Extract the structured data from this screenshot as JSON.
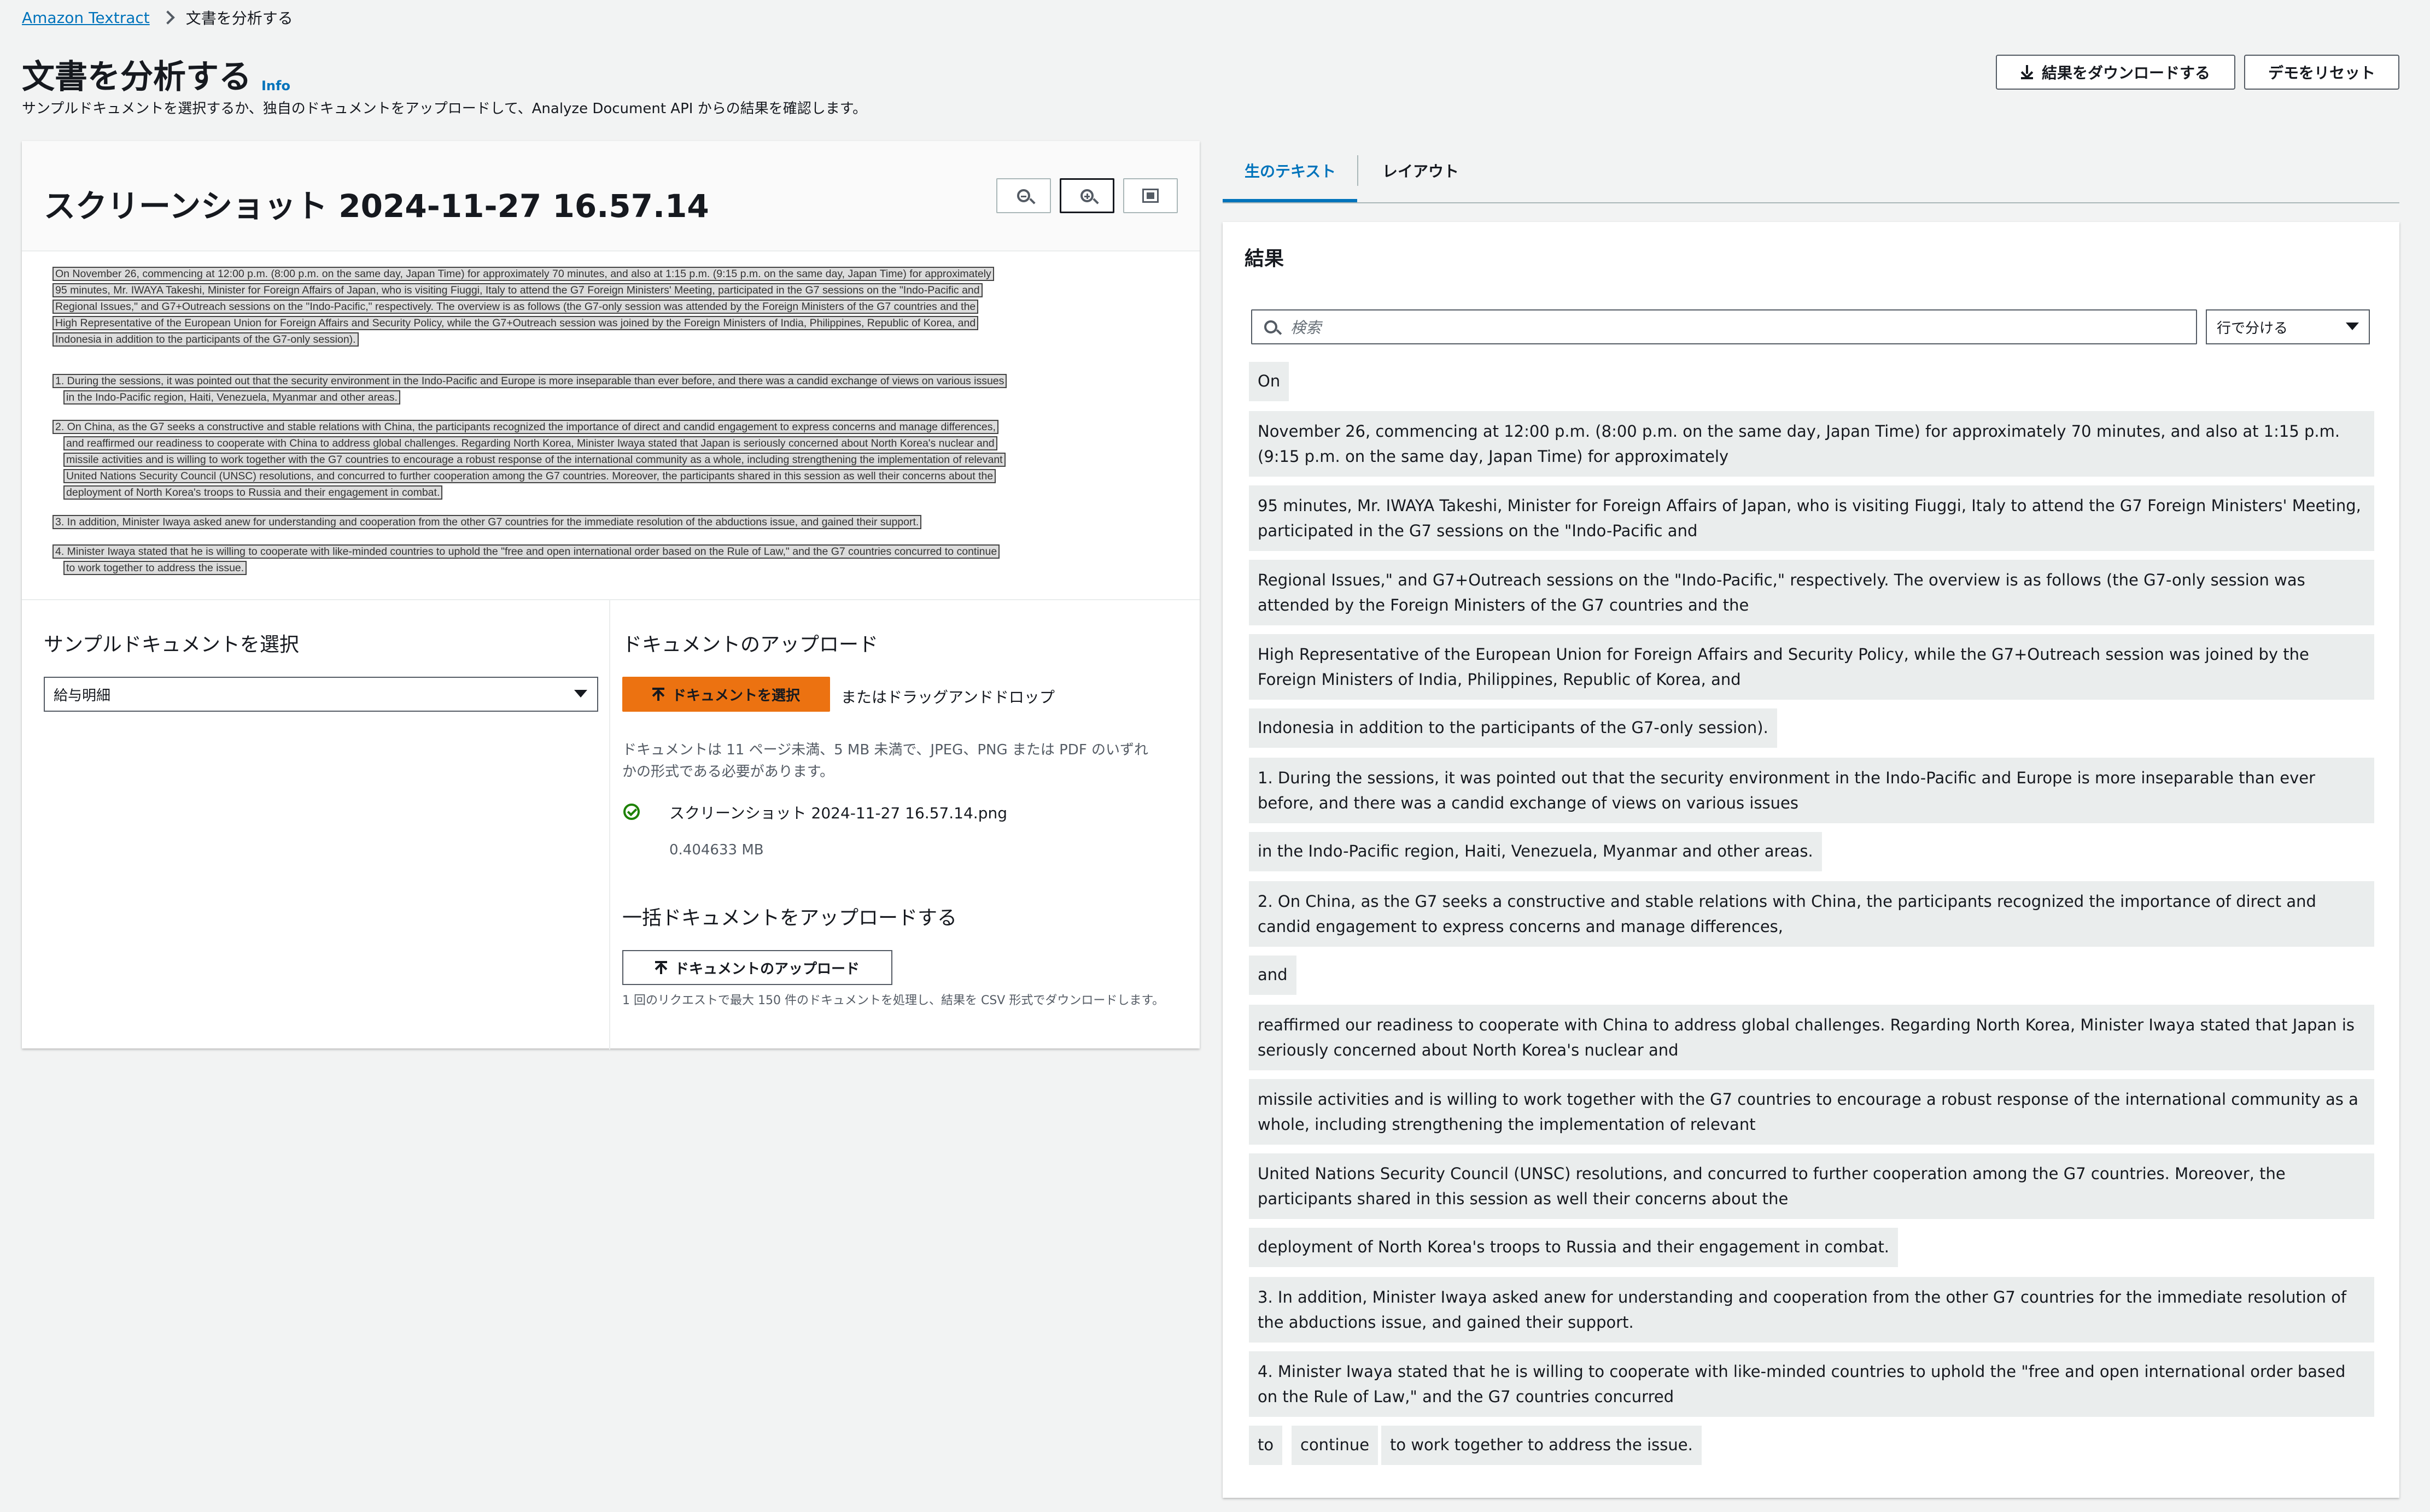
{
  "breadcrumb": {
    "root": "Amazon Textract",
    "current": "文書を分析する"
  },
  "header": {
    "title": "文書を分析する",
    "info": "Info",
    "description": "サンプルドキュメントを選択するか、独自のドキュメントをアップロードして、Analyze Document API からの結果を確認します。",
    "download_label": "結果をダウンロードする",
    "reset_label": "デモをリセット"
  },
  "document": {
    "title": "スクリーンショット 2024-11-27 16.57.14",
    "preview_lines": [
      "On November 26, commencing at 12:00 p.m. (8:00 p.m. on the same day, Japan Time) for approximately 70 minutes, and also at 1:15 p.m. (9:15 p.m. on the same day, Japan Time) for approximately",
      "95 minutes, Mr. IWAYA Takeshi, Minister for Foreign Affairs of Japan, who is visiting Fiuggi, Italy to attend the G7 Foreign Ministers' Meeting, participated in the G7 sessions on the \"Indo-Pacific and",
      "Regional Issues,\" and G7+Outreach sessions on the \"Indo-Pacific,\" respectively. The overview is as follows (the G7-only session was attended by the Foreign Ministers of the G7 countries and the",
      "High Representative of the European Union for Foreign Affairs and Security Policy, while the G7+Outreach session was joined by the Foreign Ministers of India, Philippines, Republic of Korea, and",
      "Indonesia in addition to the participants of the G7-only session).",
      "1. During the sessions, it was pointed out that the security environment in the Indo-Pacific and Europe is more inseparable than ever before, and there was a candid exchange of views on various issues",
      "in the Indo-Pacific region, Haiti, Venezuela, Myanmar and other areas.",
      "2. On China, as the G7 seeks a constructive and stable relations with China, the participants recognized the importance of direct and candid engagement to express concerns and manage differences,",
      "and reaffirmed our readiness to cooperate with China to address global challenges. Regarding North Korea, Minister Iwaya stated that Japan is seriously concerned about North Korea's nuclear and",
      "missile activities and is willing to work together with the G7 countries to encourage a robust response of the international community as a whole, including strengthening the implementation of relevant",
      "United Nations Security Council (UNSC) resolutions, and concurred to further cooperation among the G7 countries. Moreover, the participants shared in this session as well their concerns about the",
      "deployment of North Korea's troops to Russia and their engagement in combat.",
      "3. In addition, Minister Iwaya asked anew for understanding and cooperation from the other G7 countries for the immediate resolution of the abductions issue, and gained their support.",
      "4. Minister Iwaya stated that he is willing to cooperate with like-minded countries to uphold the \"free and open international order based on the Rule of Law,\" and the G7 countries concurred to continue",
      "to work together to address the issue."
    ]
  },
  "sample": {
    "label": "サンプルドキュメントを選択",
    "selected": "給与明細"
  },
  "upload": {
    "label": "ドキュメントのアップロード",
    "choose_button": "ドキュメントを選択",
    "or_drop": "またはドラッグアンドドロップ",
    "hint_line1": "ドキュメントは 11 ページ未満、5 MB 未満で、JPEG、PNG または PDF のいずれ",
    "hint_line2": "かの形式である必要があります。",
    "file_name": "スクリーンショット 2024-11-27 16.57.14.png",
    "file_size": "0.404633 MB"
  },
  "bulk": {
    "label": "一括ドキュメントをアップロードする",
    "button": "ドキュメントのアップロード",
    "hint": "1 回のリクエストで最大 150 件のドキュメントを処理し、結果を CSV 形式でダウンロードします。"
  },
  "tabs": {
    "raw": "生のテキスト",
    "layout": "レイアウト"
  },
  "results": {
    "title": "結果",
    "search_placeholder": "検索",
    "split_option": "行で分ける",
    "chips": [
      "On",
      "November 26, commencing at 12:00 p.m. (8:00 p.m. on the same day, Japan Time) for approximately 70 minutes, and also at 1:15 p.m. (9:15 p.m. on the same day, Japan Time) for approximately",
      "95 minutes, Mr. IWAYA Takeshi, Minister for Foreign Affairs of Japan, who is visiting Fiuggi, Italy to attend the G7 Foreign Ministers' Meeting, participated in the G7 sessions on the \"Indo-Pacific and",
      "Regional Issues,\" and G7+Outreach sessions on the \"Indo-Pacific,\" respectively. The overview is as follows (the G7-only session was attended by the Foreign Ministers of the G7 countries and the",
      "High Representative of the European Union for Foreign Affairs and Security Policy, while the G7+Outreach session was joined by the Foreign Ministers of India, Philippines, Republic of Korea, and",
      "Indonesia in addition to the participants of the G7-only session).",
      "1. During the sessions, it was pointed out that the security environment in the Indo-Pacific and Europe is more inseparable than ever before, and there was a candid exchange of views on various issues",
      "in the Indo-Pacific region, Haiti, Venezuela, Myanmar and other areas.",
      "2. On China, as the G7 seeks a constructive and stable relations with China, the participants recognized the importance of direct and candid engagement to express concerns and manage differences,",
      "and",
      "reaffirmed our readiness to cooperate with China to address global challenges. Regarding North Korea, Minister Iwaya stated that Japan is seriously concerned about North Korea's nuclear and",
      "missile activities and is willing to work together with the G7 countries to encourage a robust response of the international community as a whole, including strengthening the implementation of relevant",
      "United Nations Security Council (UNSC) resolutions, and concurred to further cooperation among the G7 countries. Moreover, the participants shared in this session as well their concerns about the",
      "deployment of North Korea's troops to Russia and their engagement in combat.",
      "3. In addition, Minister Iwaya asked anew for understanding and cooperation from the other G7 countries for the immediate resolution of the abductions issue, and gained their support.",
      "4. Minister Iwaya stated that he is willing to cooperate with like-minded countries to uphold the \"free and open international order based on the Rule of Law,\" and the G7 countries concurred",
      "to",
      "continue",
      "to work together to address the issue."
    ]
  },
  "colors": {
    "accent": "#0073bb",
    "primary_button": "#ec7211",
    "success": "#1d8102",
    "chip_bg": "#eaeded"
  }
}
